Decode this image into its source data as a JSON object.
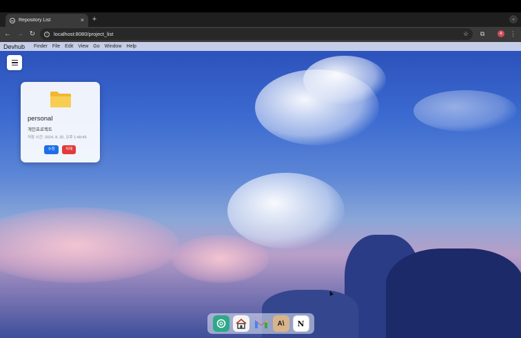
{
  "browser": {
    "tab_title": "Repository List",
    "tab_close": "×",
    "new_tab": "+",
    "url": "localhost:8080/project_list",
    "profile_initial": "e"
  },
  "menubar": {
    "app_name": "Devhub",
    "items": [
      "Finder",
      "File",
      "Edit",
      "View",
      "Go",
      "Window",
      "Help"
    ]
  },
  "project_card": {
    "title": "personal",
    "description": "개인프로젝트",
    "saved_time": "저장 시간: 2024. 8. 20. 오후 1:48:49",
    "edit_label": "수정",
    "delete_label": "삭제"
  },
  "dock": {
    "items": [
      "chatgpt-icon",
      "home-icon",
      "gmail-icon",
      "anthropic-icon",
      "notion-icon"
    ]
  },
  "colors": {
    "edit_button": "#1e6ee8",
    "delete_button": "#e23a3a",
    "folder": "#f5c542"
  }
}
